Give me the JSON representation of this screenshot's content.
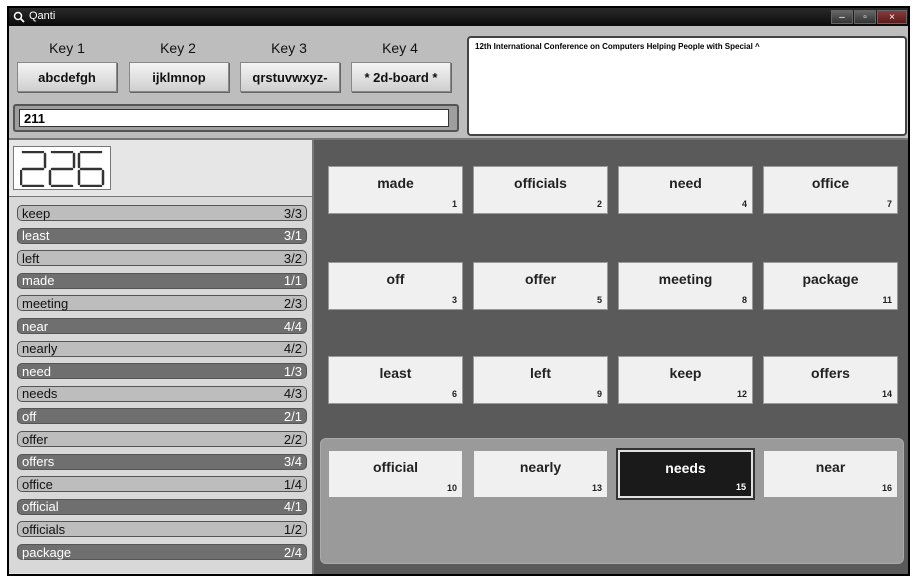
{
  "window": {
    "title": "Qanti",
    "minimize": "–",
    "restore": "▫",
    "close": "×"
  },
  "keys": [
    {
      "label": "Key 1",
      "value": "abcdefgh"
    },
    {
      "label": "Key 2",
      "value": "ijklmnop"
    },
    {
      "label": "Key 3",
      "value": "qrstuvwxyz-"
    },
    {
      "label": "Key 4",
      "value": "* 2d-board *"
    }
  ],
  "input_value": "211",
  "text_panel": "12th International Conference on Computers Helping People with Special ^",
  "counter": "226",
  "word_list": [
    {
      "word": "keep",
      "code": "3/3",
      "style": "light"
    },
    {
      "word": "least",
      "code": "3/1",
      "style": "dark"
    },
    {
      "word": "left",
      "code": "3/2",
      "style": "light"
    },
    {
      "word": "made",
      "code": "1/1",
      "style": "dark"
    },
    {
      "word": "meeting",
      "code": "2/3",
      "style": "light"
    },
    {
      "word": "near",
      "code": "4/4",
      "style": "dark"
    },
    {
      "word": "nearly",
      "code": "4/2",
      "style": "light"
    },
    {
      "word": "need",
      "code": "1/3",
      "style": "dark"
    },
    {
      "word": "needs",
      "code": "4/3",
      "style": "light"
    },
    {
      "word": "off",
      "code": "2/1",
      "style": "dark"
    },
    {
      "word": "offer",
      "code": "2/2",
      "style": "light"
    },
    {
      "word": "offers",
      "code": "3/4",
      "style": "dark"
    },
    {
      "word": "office",
      "code": "1/4",
      "style": "light"
    },
    {
      "word": "official",
      "code": "4/1",
      "style": "dark"
    },
    {
      "word": "officials",
      "code": "1/2",
      "style": "light"
    },
    {
      "word": "package",
      "code": "2/4",
      "style": "dark"
    }
  ],
  "grid": [
    [
      {
        "word": "made",
        "num": "1"
      },
      {
        "word": "officials",
        "num": "2"
      },
      {
        "word": "need",
        "num": "4"
      },
      {
        "word": "office",
        "num": "7"
      }
    ],
    [
      {
        "word": "off",
        "num": "3"
      },
      {
        "word": "offer",
        "num": "5"
      },
      {
        "word": "meeting",
        "num": "8"
      },
      {
        "word": "package",
        "num": "11"
      }
    ],
    [
      {
        "word": "least",
        "num": "6"
      },
      {
        "word": "left",
        "num": "9"
      },
      {
        "word": "keep",
        "num": "12"
      },
      {
        "word": "offers",
        "num": "14"
      }
    ],
    [
      {
        "word": "official",
        "num": "10"
      },
      {
        "word": "nearly",
        "num": "13"
      },
      {
        "word": "needs",
        "num": "15"
      },
      {
        "word": "near",
        "num": "16"
      }
    ]
  ],
  "selected_word": "needs"
}
